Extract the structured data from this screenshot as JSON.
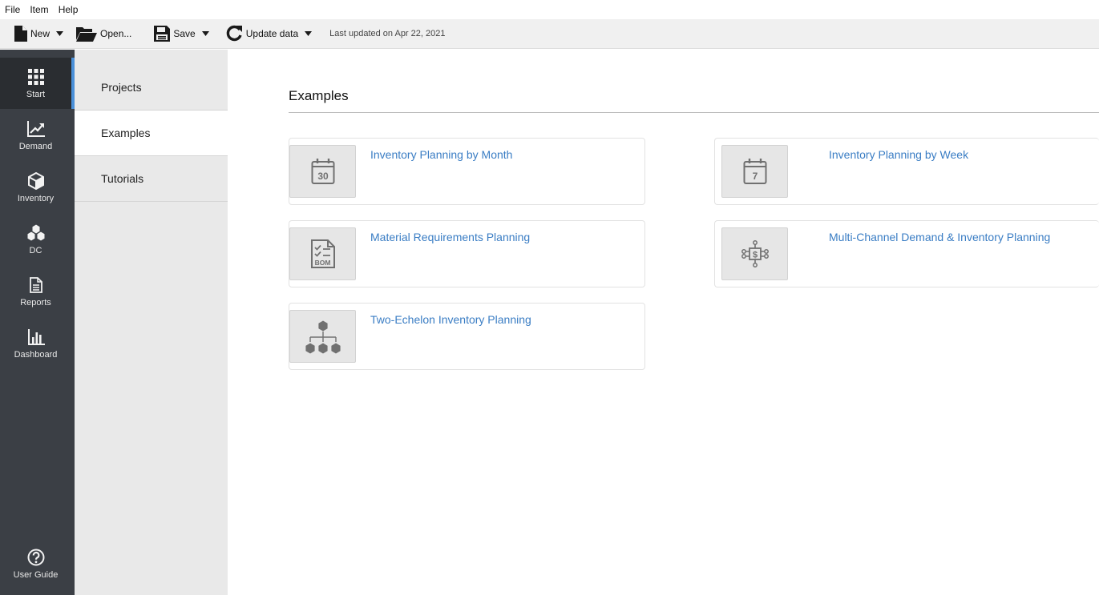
{
  "menubar": {
    "items": [
      "File",
      "Item",
      "Help"
    ]
  },
  "toolbar": {
    "new_label": "New",
    "open_label": "Open...",
    "save_label": "Save",
    "update_label": "Update data",
    "status": "Last updated on Apr 22, 2021"
  },
  "rail": {
    "items": [
      {
        "label": "Start",
        "icon": "grid-icon"
      },
      {
        "label": "Demand",
        "icon": "trend-chart-icon"
      },
      {
        "label": "Inventory",
        "icon": "box-icon"
      },
      {
        "label": "DC",
        "icon": "boxes-stack-icon"
      },
      {
        "label": "Reports",
        "icon": "document-icon"
      },
      {
        "label": "Dashboard",
        "icon": "bar-chart-icon"
      }
    ],
    "guide_label": "User Guide"
  },
  "subnav": {
    "items": [
      "Projects",
      "Examples",
      "Tutorials"
    ]
  },
  "main": {
    "title": "Examples",
    "cards": [
      {
        "title": "Inventory Planning by Month",
        "icon": "calendar-30-icon",
        "icon_text": "30"
      },
      {
        "title": "Inventory Planning by Week",
        "icon": "calendar-7-icon",
        "icon_text": "7"
      },
      {
        "title": "Material Requirements Planning",
        "icon": "bom-checklist-icon",
        "icon_text": "BOM"
      },
      {
        "title": "Multi-Channel Demand & Inventory Planning",
        "icon": "dollar-network-icon",
        "icon_text": "$"
      },
      {
        "title": "Two-Echelon Inventory Planning",
        "icon": "hierarchy-boxes-icon"
      }
    ]
  },
  "colors": {
    "rail_bg": "#3b3f45",
    "accent": "#4a90d9",
    "link": "#3a7dc4",
    "subnav_bg": "#e9e9e9"
  }
}
